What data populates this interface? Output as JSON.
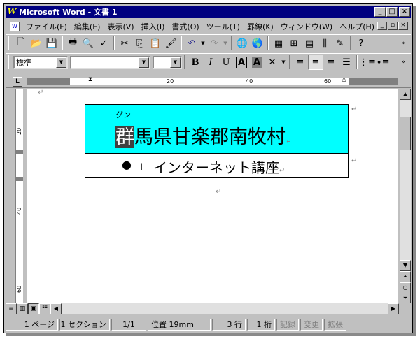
{
  "window": {
    "title": "Microsoft Word - 文書 1",
    "app_icon": "W"
  },
  "menu": [
    "ファイル(F)",
    "編集(E)",
    "表示(V)",
    "挿入(I)",
    "書式(O)",
    "ツール(T)",
    "罫線(K)",
    "ウィンドウ(W)",
    "ヘルプ(H)"
  ],
  "format": {
    "style": "標準",
    "font": "",
    "size": ""
  },
  "ruler": {
    "h_ticks": [
      "20",
      "40",
      "60"
    ],
    "v_ticks": [
      "20",
      "40",
      "60"
    ]
  },
  "document": {
    "ruby": "グン",
    "heading_first_char": "群",
    "heading_rest": "馬県甘楽郡南牧村",
    "bullet": "●",
    "course": "インターネット講座",
    "para_mark": "↵"
  },
  "status": {
    "page": "1 ページ",
    "section": "1 セクション",
    "pages": "1/1",
    "position": "位置 19mm",
    "line": "3 行",
    "col": "1 桁",
    "rec": "記録",
    "trk": "変更",
    "ext": "拡張"
  },
  "colors": {
    "title_bar": "#000080",
    "table_cell": "#00ffff"
  }
}
